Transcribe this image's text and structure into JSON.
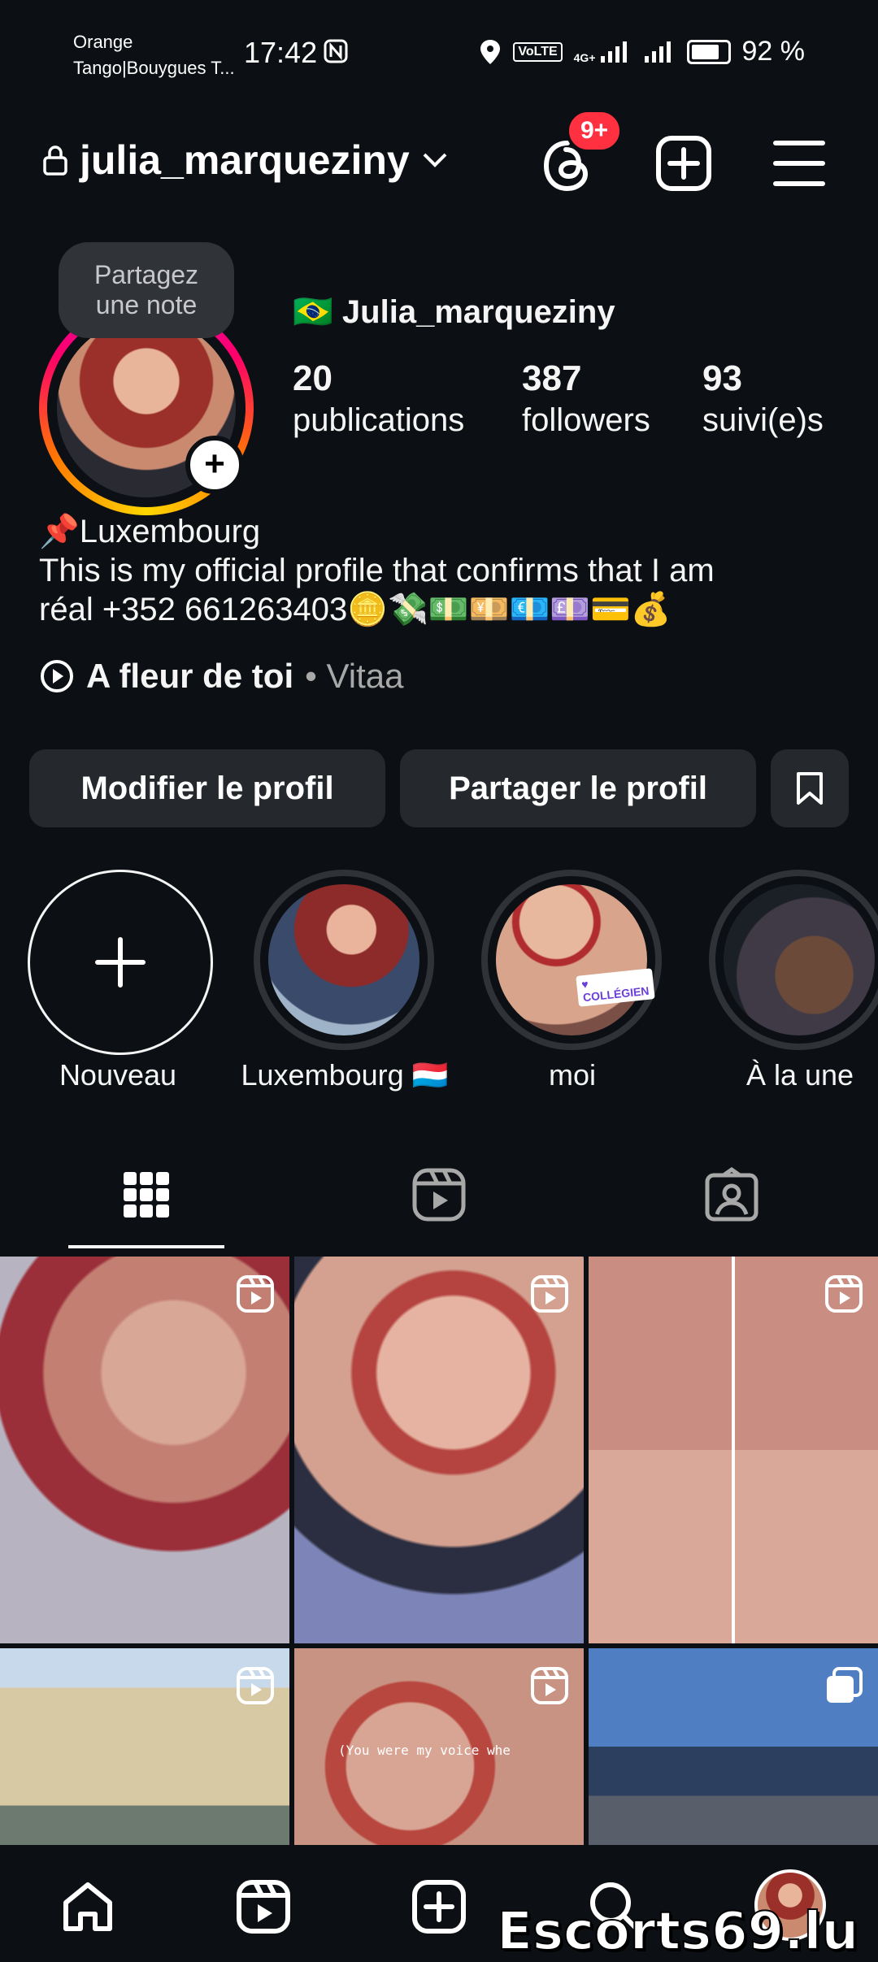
{
  "status_bar": {
    "carrier_line1": "Orange",
    "carrier_line2": "Tango|Bouygues T...",
    "time": "17:42",
    "battery": "92 %",
    "battery_level": 0.92,
    "volte": "VoLTE",
    "network": "4G+"
  },
  "header": {
    "username": "julia_marqueziny",
    "threads_badge": "9+"
  },
  "profile": {
    "note_text": "Partagez une note",
    "display_name": "🇧🇷 Julia_marqueziny",
    "stats": [
      {
        "value": "20",
        "label": "publications"
      },
      {
        "value": "387",
        "label": "followers"
      },
      {
        "value": "93",
        "label": "suivi(e)s"
      }
    ],
    "bio_line1": "📌Luxembourg",
    "bio_line2": "This is my official profile that confirms that I am",
    "bio_line3": "réal +352 661263403🪙💸💵💴💶💷💳💰",
    "music_title": "A fleur de toi",
    "music_artist": "• Vitaa"
  },
  "buttons": {
    "edit": "Modifier le profil",
    "share": "Partager le profil"
  },
  "highlights": [
    {
      "label": "Nouveau"
    },
    {
      "label": "Luxembourg 🇱🇺"
    },
    {
      "label": "moi"
    },
    {
      "label": "À la une"
    }
  ],
  "highlight_sticker": "♥ COLLÉGIEN",
  "tabs": [
    "grid",
    "reels",
    "tagged"
  ],
  "posts": {
    "caption_overlay": "(You were my voice whe"
  },
  "watermark": "Escorts69.lu",
  "colors": {
    "background": "#0c1014",
    "button": "#25292e",
    "badge": "#ff3040"
  }
}
